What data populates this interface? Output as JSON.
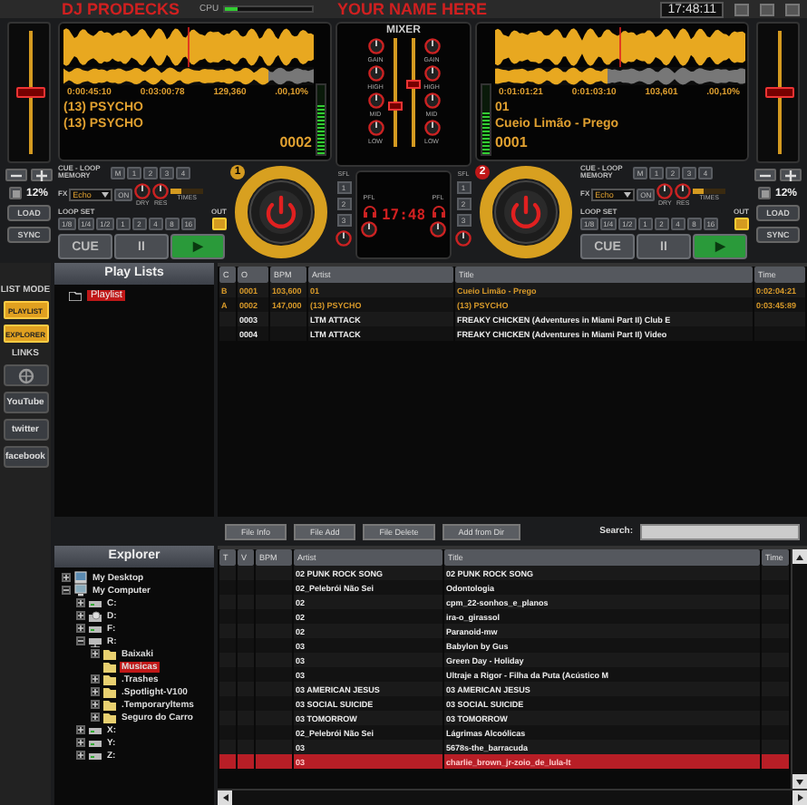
{
  "title_bar": {
    "app_name": "DJ PRODECKS",
    "cpu_label": "CPU",
    "cpu_meter": {
      "level": 0.15
    },
    "banner": "YOUR NAME HERE",
    "clock": "17:48:11"
  },
  "decks": [
    {
      "number": "1",
      "elapsed": "0:00:45:10",
      "remaining": "0:03:00:78",
      "bpm": "129,360",
      "pitch_readout": ".00,10%",
      "artist": "(13) PSYCHO",
      "title": "(13) PSYCHO",
      "track_number": "0002",
      "progress": {
        "level": 0.82
      },
      "vu": {
        "level": 0.7
      },
      "pitch": {
        "level": 0.5
      },
      "pitch_value": "12%",
      "load": "LOAD",
      "sync": "SYNC",
      "memory_label": "CUE - LOOP MEMORY",
      "memory_buttons": [
        "M",
        "1",
        "2",
        "3",
        "4"
      ],
      "fx_label": "FX",
      "fx_name": "Echo",
      "fx_on": "ON",
      "fx_knobs": [
        "DRY",
        "RES"
      ],
      "fx_times": "TIMES",
      "loop_label": "LOOP SET",
      "loop_out": "OUT",
      "loop_buttons": [
        "1/8",
        "1/4",
        "1/2",
        "1",
        "2",
        "4",
        "8",
        "16"
      ],
      "cue": "CUE",
      "pause": "II",
      "play": "▶"
    },
    {
      "number": "2",
      "elapsed": "0:01:01:21",
      "remaining": "0:01:03:10",
      "bpm": "103,601",
      "pitch_readout": ".00,10%",
      "artist": "01",
      "title": "Cueio Limão - Prego",
      "track_number": "0001",
      "progress": {
        "level": 0.45
      },
      "vu": {
        "level": 0.6
      },
      "pitch": {
        "level": 0.5
      },
      "pitch_value": "12%",
      "load": "LOAD",
      "sync": "SYNC",
      "memory_label": "CUE - LOOP MEMORY",
      "memory_buttons": [
        "M",
        "1",
        "2",
        "3",
        "4"
      ],
      "fx_label": "FX",
      "fx_name": "Echo",
      "fx_on": "ON",
      "fx_knobs": [
        "DRY",
        "RES"
      ],
      "fx_times": "TIMES",
      "loop_label": "LOOP SET",
      "loop_out": "OUT",
      "loop_buttons": [
        "1/8",
        "1/4",
        "1/2",
        "1",
        "2",
        "4",
        "8",
        "16"
      ],
      "cue": "CUE",
      "pause": "II",
      "play": "▶"
    }
  ],
  "mixer": {
    "title": "MIXER",
    "channels": [
      {
        "knob_labels": [
          "GAIN",
          "HIGH",
          "MID",
          "LOW"
        ],
        "fader": {
          "level": 0.4
        }
      },
      {
        "knob_labels": [
          "GAIN",
          "HIGH",
          "MID",
          "LOW"
        ],
        "fader": {
          "level": 0.6
        }
      }
    ],
    "sfl": [
      {
        "label": "SFL",
        "buttons": [
          "1",
          "2",
          "3"
        ]
      },
      {
        "label": "SFL",
        "buttons": [
          "1",
          "2",
          "3"
        ]
      }
    ],
    "pfl_labels": [
      "PFL",
      "PFL"
    ],
    "clock": "17:48"
  },
  "sidebar": {
    "mode_label": "LIST MODE",
    "modes": [
      "PLAYLIST",
      "EXPLORER"
    ],
    "links_label": "LINKS",
    "links": [
      {
        "kind": "web"
      },
      {
        "kind": "youtube",
        "label": "YouTube"
      },
      {
        "kind": "twitter",
        "label": "twitter"
      },
      {
        "kind": "facebook",
        "label": "facebook"
      }
    ]
  },
  "playlists": {
    "title": "Play Lists",
    "items": [
      {
        "label": "Playlist",
        "selected": true
      }
    ]
  },
  "playlist_table": {
    "columns": [
      "C",
      "O",
      "BPM",
      "Artist",
      "Title",
      "Time"
    ],
    "rows": [
      {
        "c": "B",
        "o": "0001",
        "bpm": "103,600",
        "artist": "01",
        "title": "Cueio Limão - Prego",
        "time": "0:02:04:21",
        "loaded": true
      },
      {
        "c": "A",
        "o": "0002",
        "bpm": "147,000",
        "artist": "(13) PSYCHO",
        "title": "(13) PSYCHO",
        "time": "0:03:45:89",
        "loaded": true
      },
      {
        "o": "0003",
        "artist": "LTM ATTACK",
        "title": "FREAKY CHICKEN (Adventures in Miami Part II) Club E",
        "loaded": false
      },
      {
        "o": "0004",
        "artist": "LTM ATTACK",
        "title": "FREAKY CHICKEN (Adventures in Miami Part II) Video",
        "loaded": false
      }
    ]
  },
  "file_buttons": [
    "File Info",
    "File Add",
    "File Delete",
    "Add from Dir"
  ],
  "search": {
    "label": "Search:"
  },
  "explorer": {
    "title": "Explorer",
    "tree": [
      {
        "label": "My Desktop",
        "kind": "desktop",
        "expanded": false,
        "selected": false
      },
      {
        "label": "My Computer",
        "kind": "computer",
        "expanded": true,
        "selected": false,
        "children": [
          {
            "label": "C:",
            "kind": "drive",
            "expanded": false,
            "selected": false
          },
          {
            "label": "D:",
            "kind": "cd-drive",
            "expanded": false,
            "selected": false
          },
          {
            "label": "F:",
            "kind": "drive",
            "expanded": false,
            "selected": false
          },
          {
            "label": "R:",
            "kind": "network-drive",
            "expanded": true,
            "selected": false,
            "children": [
              {
                "label": "Baixaki",
                "kind": "folder",
                "expanded": false,
                "selected": false
              },
              {
                "label": "Musicas",
                "kind": "folder",
                "selected": true
              },
              {
                "label": ".Trashes",
                "kind": "folder",
                "expanded": false,
                "selected": false
              },
              {
                "label": ".Spotlight-V100",
                "kind": "folder",
                "expanded": false,
                "selected": false
              },
              {
                "label": ".Temporaryltems",
                "kind": "folder",
                "expanded": false,
                "selected": false
              },
              {
                "label": "Seguro do Carro",
                "kind": "folder",
                "expanded": false,
                "selected": false
              }
            ]
          },
          {
            "label": "X:",
            "kind": "drive",
            "expanded": false,
            "selected": false
          },
          {
            "label": "Y:",
            "kind": "drive",
            "expanded": false,
            "selected": false
          },
          {
            "label": "Z:",
            "kind": "drive",
            "expanded": false,
            "selected": false
          }
        ]
      }
    ]
  },
  "file_table": {
    "columns": [
      "T",
      "V",
      "BPM",
      "Artist",
      "Title",
      "Time"
    ],
    "rows": [
      {
        "artist": "02 PUNK ROCK SONG",
        "title": "02 PUNK ROCK SONG",
        "selected": false
      },
      {
        "artist": "02_Pelebrói Não Sei",
        "title": "Odontologia",
        "selected": false
      },
      {
        "artist": "02",
        "title": "cpm_22-sonhos_e_planos",
        "selected": false
      },
      {
        "artist": "02",
        "title": "ira-o_girassol",
        "selected": false
      },
      {
        "artist": "02",
        "title": "Paranoid-mw",
        "selected": false
      },
      {
        "artist": "03",
        "title": "Babylon by Gus",
        "selected": false
      },
      {
        "artist": "03",
        "title": "Green Day -  Holiday",
        "selected": false
      },
      {
        "artist": "03",
        "title": "Ultraje a Rigor - Filha da Puta (Acústico M",
        "selected": false
      },
      {
        "artist": "03 AMERICAN JESUS",
        "title": "03 AMERICAN JESUS",
        "selected": false
      },
      {
        "artist": "03 SOCIAL SUICIDE",
        "title": "03 SOCIAL SUICIDE",
        "selected": false
      },
      {
        "artist": "03 TOMORROW",
        "title": "03 TOMORROW",
        "selected": false
      },
      {
        "artist": "02_Pelebrói Não Sei",
        "title": "Lágrimas Alcoólicas",
        "selected": false
      },
      {
        "artist": "03",
        "title": "5678s-the_barracuda",
        "selected": false
      },
      {
        "artist": "03",
        "title": "charlie_brown_jr-zoio_de_lula-lt",
        "selected": true
      }
    ]
  }
}
